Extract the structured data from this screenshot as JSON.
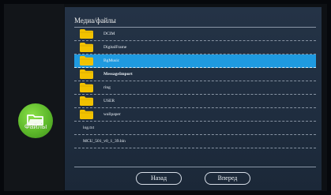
{
  "app": {
    "label": "Файлы",
    "icon": "folder-icon"
  },
  "panel": {
    "title": "Медиа/файлы"
  },
  "items": [
    {
      "name": "DCIM",
      "kind": "folder",
      "selected": false,
      "bold": false
    },
    {
      "name": "DigitalFrame",
      "kind": "folder",
      "selected": false,
      "bold": false
    },
    {
      "name": "BgMusic",
      "kind": "folder",
      "selected": true,
      "bold": false
    },
    {
      "name": "MessageImport",
      "kind": "folder",
      "selected": false,
      "bold": true
    },
    {
      "name": "ring",
      "kind": "folder",
      "selected": false,
      "bold": false
    },
    {
      "name": "USER",
      "kind": "folder",
      "selected": false,
      "bold": false
    },
    {
      "name": "wallpaper",
      "kind": "folder",
      "selected": false,
      "bold": false
    },
    {
      "name": "log.txt",
      "kind": "file",
      "selected": false,
      "bold": false
    },
    {
      "name": "MCU_501_v0_1_39.bin",
      "kind": "file",
      "selected": false,
      "bold": false
    }
  ],
  "buttons": {
    "back_label": "Назад",
    "forward_label": "Вперед"
  },
  "colors": {
    "accent": "#1f9ae0",
    "folder": "#f2c200",
    "app_icon": "#5cb82a",
    "background": "#1f2d3f"
  }
}
